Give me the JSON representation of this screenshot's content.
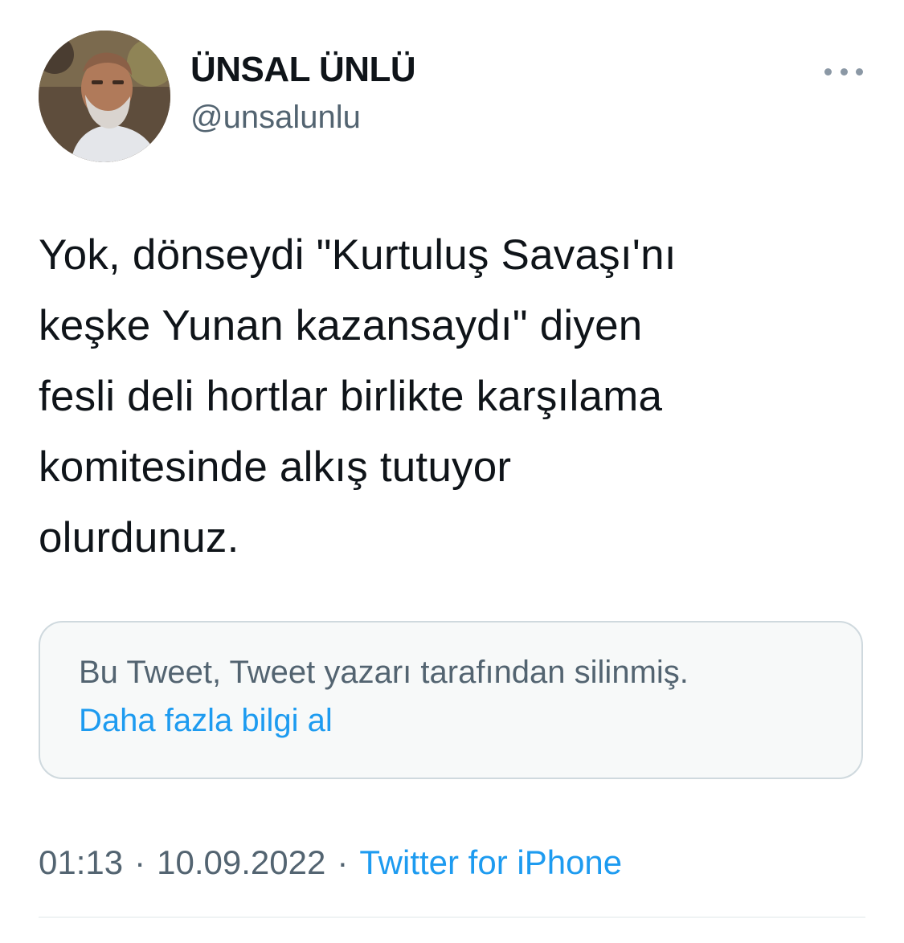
{
  "author": {
    "name": "ÜNSAL ÜNLÜ",
    "handle": "@unsalunlu"
  },
  "tweet": {
    "lines": [
      "Yok, dönseydi \"Kurtuluş Savaşı'nı",
      "keşke Yunan kazansaydı\" diyen",
      "fesli deli hortlar birlikte karşılama",
      "komitesinde alkış tutuyor",
      "olurdunuz."
    ]
  },
  "quoted_tweet": {
    "notice": "Bu Tweet, Tweet yazarı tarafından silinmiş.",
    "link_label": "Daha fazla bilgi al"
  },
  "meta": {
    "time": "01:13",
    "date": "10.09.2022",
    "separator": "·",
    "source": "Twitter for iPhone"
  },
  "icons": {
    "more": "more-horizontal-icon"
  },
  "colors": {
    "text_primary": "#0f1419",
    "text_secondary": "#536471",
    "link": "#1d9bf0",
    "card_background": "#f7f9f9",
    "card_border": "#cfd9de"
  }
}
